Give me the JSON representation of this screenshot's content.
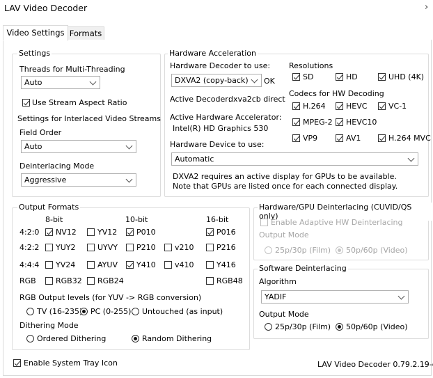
{
  "window": {
    "title": "LAV Video Decoder"
  },
  "tabs": [
    {
      "label": "Video Settings",
      "active": true
    },
    {
      "label": "Formats",
      "active": false
    }
  ],
  "settings": {
    "group_label": "Settings",
    "threads_label": "Threads for Multi-Threading",
    "threads_value": "Auto",
    "stream_aspect_label": "Use Stream Aspect Ratio",
    "stream_aspect_checked": true,
    "interlaced_label": "Settings for Interlaced Video Streams",
    "field_order_label": "Field Order",
    "field_order_value": "Auto",
    "deint_mode_label": "Deinterlacing Mode",
    "deint_mode_value": "Aggressive"
  },
  "hwaccel": {
    "group_label": "Hardware Acceleration",
    "decoder_label": "Hardware Decoder to use:",
    "decoder_value": "DXVA2 (copy-back)",
    "decoder_status": "OK",
    "active_decoder_label": "Active Decoder:",
    "active_decoder_value": "dxva2cb direct",
    "active_accel_label": "Active Hardware Accelerator:",
    "active_accel_value": "Intel(R) HD Graphics 530",
    "device_label": "Hardware Device to use:",
    "device_value": "Automatic",
    "note_line1": "DXVA2 requires an active display for GPUs to be available.",
    "note_line2": "Note that GPUs are listed once for each connected display.",
    "resolutions_label": "Resolutions",
    "resolutions": [
      {
        "label": "SD",
        "checked": true
      },
      {
        "label": "HD",
        "checked": true
      },
      {
        "label": "UHD (4K)",
        "checked": true
      }
    ],
    "codecs_label": "Codecs for HW Decoding",
    "codecs": [
      {
        "label": "H.264",
        "checked": true
      },
      {
        "label": "HEVC",
        "checked": true
      },
      {
        "label": "VC-1",
        "checked": true
      },
      {
        "label": "MPEG-2",
        "checked": true
      },
      {
        "label": "HEVC10",
        "checked": true
      },
      {
        "label": "VP9",
        "checked": true
      },
      {
        "label": "AV1",
        "checked": true
      },
      {
        "label": "H.264 MVC",
        "checked": true
      }
    ]
  },
  "output_formats": {
    "group_label": "Output Formats",
    "col_headers": [
      "8-bit",
      "10-bit",
      "16-bit"
    ],
    "rows": [
      {
        "label": "4:2:0",
        "items": [
          {
            "label": "NV12",
            "checked": true
          },
          {
            "label": "YV12",
            "checked": false
          },
          {
            "label": "P010",
            "checked": true
          },
          {
            "label": "P016",
            "checked": true
          }
        ]
      },
      {
        "label": "4:2:2",
        "items": [
          {
            "label": "YUY2",
            "checked": false
          },
          {
            "label": "UYVY",
            "checked": false
          },
          {
            "label": "P210",
            "checked": false
          },
          {
            "label": "v210",
            "checked": false
          },
          {
            "label": "P216",
            "checked": false
          }
        ]
      },
      {
        "label": "4:4:4",
        "items": [
          {
            "label": "YV24",
            "checked": false
          },
          {
            "label": "AYUV",
            "checked": false
          },
          {
            "label": "Y410",
            "checked": true
          },
          {
            "label": "v410",
            "checked": false
          },
          {
            "label": "Y416",
            "checked": false
          }
        ]
      },
      {
        "label": "RGB",
        "items": [
          {
            "label": "RGB32",
            "checked": false
          },
          {
            "label": "RGB24",
            "checked": false
          },
          {
            "label": "RGB48",
            "checked": false
          }
        ]
      }
    ],
    "rgb_levels_label": "RGB Output levels (for YUV -> RGB conversion)",
    "rgb_levels": [
      {
        "label": "TV (16-235)",
        "selected": false
      },
      {
        "label": "PC (0-255)",
        "selected": true
      },
      {
        "label": "Untouched (as input)",
        "selected": false
      }
    ],
    "dither_label": "Dithering Mode",
    "dither": [
      {
        "label": "Ordered Dithering",
        "selected": false
      },
      {
        "label": "Random Dithering",
        "selected": true
      }
    ]
  },
  "hw_deint": {
    "group_label": "Hardware/GPU Deinterlacing (CUVID/QS only)",
    "enable_label": "Enable Adaptive HW Deinterlacing",
    "enable_checked": false,
    "output_mode_label": "Output Mode",
    "modes": [
      {
        "label": "25p/30p (Film)",
        "selected": false
      },
      {
        "label": "50p/60p (Video)",
        "selected": true
      }
    ]
  },
  "sw_deint": {
    "group_label": "Software Deinterlacing",
    "algorithm_label": "Algorithm",
    "algorithm_value": "YADIF",
    "output_mode_label": "Output Mode",
    "modes": [
      {
        "label": "25p/30p (Film)",
        "selected": false
      },
      {
        "label": "50p/60p (Video)",
        "selected": true
      }
    ]
  },
  "footer": {
    "tray_label": "Enable System Tray Icon",
    "tray_checked": true,
    "version": "LAV Video Decoder 0.79.2.19-git"
  }
}
